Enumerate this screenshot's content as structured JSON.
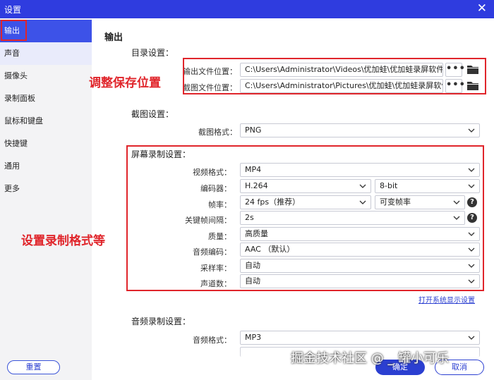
{
  "window": {
    "title": "设置",
    "close_glyph": "✕"
  },
  "sidebar": {
    "items": [
      {
        "label": "输出"
      },
      {
        "label": "声音"
      },
      {
        "label": "摄像头"
      },
      {
        "label": "录制面板"
      },
      {
        "label": "鼠标和键盘"
      },
      {
        "label": "快捷键"
      },
      {
        "label": "通用"
      },
      {
        "label": "更多"
      }
    ],
    "reset_label": "重置"
  },
  "main": {
    "title": "输出",
    "directory": {
      "heading": "目录设置：",
      "output_label": "输出文件位置：",
      "output_value": "C:\\Users\\Administrator\\Videos\\优加蛙\\优加蛙录屏软件",
      "screenshot_label": "截图文件位置：",
      "screenshot_value": "C:\\Users\\Administrator\\Pictures\\优加蛙\\优加蛙录屏软件",
      "dots": "•••"
    },
    "screenshot": {
      "heading": "截图设置：",
      "format_label": "截图格式：",
      "format_value": "PNG"
    },
    "recording": {
      "heading": "屏幕录制设置：",
      "video_format_label": "视频格式：",
      "video_format_value": "MP4",
      "encoder_label": "编码器：",
      "encoder_value": "H.264",
      "bitdepth_value": "8-bit",
      "framerate_label": "帧率：",
      "framerate_value": "24 fps（推荐）",
      "framerate_mode_value": "可变帧率",
      "keyframe_label": "关键帧间隔：",
      "keyframe_value": "2s",
      "quality_label": "质量：",
      "quality_value": "高质量",
      "audio_codec_label": "音频编码：",
      "audio_codec_value": "AAC （默认）",
      "samplerate_label": "采样率：",
      "samplerate_value": "自动",
      "channels_label": "声道数：",
      "channels_value": "自动",
      "help": "?"
    },
    "system_display_link": "打开系统显示设置",
    "audio": {
      "heading": "音频录制设置：",
      "format_label": "音频格式：",
      "format_value": "MP3"
    }
  },
  "annotations": {
    "note_save_location": "调整保存位置",
    "note_record_format": "设置录制格式等",
    "color": "#e0252b"
  },
  "footer": {
    "confirm_label": "确定",
    "cancel_label": "取消",
    "watermark": "掘金技术社区 @ _ 罐小可乐"
  },
  "colors": {
    "accent": "#3d52e8",
    "titlebar": "#2f3cdf"
  }
}
